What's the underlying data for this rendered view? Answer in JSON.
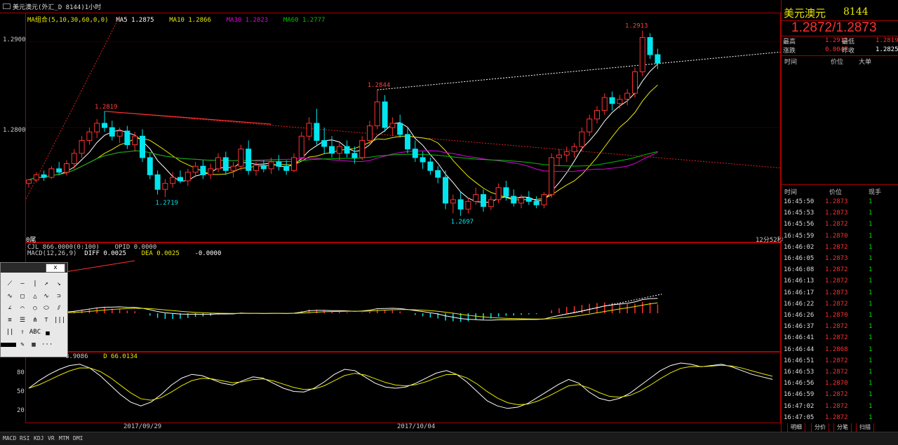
{
  "window": {
    "title": "美元澳元(外汇_D 8144)1小时"
  },
  "main_legend": {
    "ma_group": "MA组合(5,10,30,60,0,0)",
    "ma5": "MA5 1.2875",
    "ma10": "MA10 1.2866",
    "ma30": "MA30 1.2823",
    "ma60": "MA60 1.2777"
  },
  "macd_legend": {
    "cjl": "CJL 866.0000(0:100)",
    "opid": "OPID 0.0000",
    "macd": "MACD(12,26,9)",
    "diff": "DIFF 0.0025",
    "dea": "DEA 0.0025",
    "macd_val": "-0.0000"
  },
  "kdj_legend": {
    "j": "8.9086",
    "d": "D 66.0134"
  },
  "price_axis": [
    "1.2900",
    "1.2800"
  ],
  "kdj_axis": [
    "80",
    "50",
    "20"
  ],
  "date_labels": [
    "2017/09/29",
    "2017/10/04"
  ],
  "price_annotations": {
    "high1": "1.2819",
    "high2": "1.2844",
    "high3": "1.2913",
    "low1": "1.2719",
    "low2": "1.2697"
  },
  "corner_label": "0尾",
  "countdown": "12分52秒",
  "quote": {
    "name": "美元澳元",
    "code": "8144",
    "price": "1.2872/1.2873",
    "high_label": "最高",
    "high": "1.2913",
    "low_label": "最低",
    "low": "1.2819",
    "change_label": "涨跌",
    "change": "0.0047",
    "prev_label": "昨收",
    "prev": "1.2825"
  },
  "big_order_headers": [
    "时间",
    "价位",
    "大单"
  ],
  "tick_headers": [
    "时间",
    "价位",
    "现手"
  ],
  "ticks": [
    [
      "16:45:50",
      "1.2873",
      "1"
    ],
    [
      "16:45:53",
      "1.2873",
      "1"
    ],
    [
      "16:45:56",
      "1.2872",
      "1"
    ],
    [
      "16:45:59",
      "1.2870",
      "1"
    ],
    [
      "16:46:02",
      "1.2872",
      "1"
    ],
    [
      "16:46:05",
      "1.2873",
      "1"
    ],
    [
      "16:46:08",
      "1.2872",
      "1"
    ],
    [
      "16:46:13",
      "1.2872",
      "1"
    ],
    [
      "16:46:17",
      "1.2873",
      "1"
    ],
    [
      "16:46:22",
      "1.2872",
      "1"
    ],
    [
      "16:46:26",
      "1.2870",
      "1"
    ],
    [
      "16:46:37",
      "1.2872",
      "1"
    ],
    [
      "16:46:41",
      "1.2872",
      "1"
    ],
    [
      "16:46:44",
      "1.2868",
      "1"
    ],
    [
      "16:46:51",
      "1.2872",
      "1"
    ],
    [
      "16:46:53",
      "1.2872",
      "1"
    ],
    [
      "16:46:56",
      "1.2870",
      "1"
    ],
    [
      "16:46:59",
      "1.2872",
      "1"
    ],
    [
      "16:47:02",
      "1.2872",
      "1"
    ],
    [
      "16:47:05",
      "1.2872",
      "1"
    ]
  ],
  "right_tabs": [
    "明细",
    "分价",
    "分笔",
    "扫描"
  ],
  "bottom_tabs": [
    "MACD",
    "RSI",
    "KDJ",
    "VR",
    "MTM",
    "DMI"
  ],
  "toolbox": {
    "close": "x",
    "abc": "ABC"
  },
  "colors": {
    "up": "#ff3030",
    "down": "#00e5ee",
    "ma5": "#ffffff",
    "ma10": "#e8e800",
    "ma30": "#e000e0",
    "ma60": "#00c000",
    "frame": "#aa0000"
  },
  "chart_data": {
    "type": "candlestick",
    "title": "",
    "ylim": [
      1.268,
      1.2925
    ],
    "candles": [
      [
        1.2735,
        1.274,
        1.273,
        1.2739
      ],
      [
        1.2739,
        1.2748,
        1.2736,
        1.2745
      ],
      [
        1.2745,
        1.275,
        1.2738,
        1.2742
      ],
      [
        1.2742,
        1.2755,
        1.274,
        1.2752
      ],
      [
        1.2752,
        1.276,
        1.2745,
        1.2748
      ],
      [
        1.2748,
        1.2762,
        1.2744,
        1.2758
      ],
      [
        1.2758,
        1.2775,
        1.2752,
        1.277
      ],
      [
        1.277,
        1.279,
        1.2765,
        1.2785
      ],
      [
        1.2785,
        1.28,
        1.278,
        1.2795
      ],
      [
        1.2795,
        1.281,
        1.2788,
        1.2805
      ],
      [
        1.2805,
        1.2819,
        1.2795,
        1.28
      ],
      [
        1.28,
        1.2808,
        1.2785,
        1.279
      ],
      [
        1.279,
        1.28,
        1.2782,
        1.2796
      ],
      [
        1.2796,
        1.2802,
        1.2775,
        1.278
      ],
      [
        1.278,
        1.2795,
        1.2772,
        1.279
      ],
      [
        1.279,
        1.2798,
        1.276,
        1.2765
      ],
      [
        1.2765,
        1.277,
        1.274,
        1.2745
      ],
      [
        1.2745,
        1.275,
        1.2722,
        1.2728
      ],
      [
        1.2728,
        1.274,
        1.2719,
        1.2735
      ],
      [
        1.2735,
        1.2748,
        1.273,
        1.2742
      ],
      [
        1.2742,
        1.275,
        1.2735,
        1.2738
      ],
      [
        1.2738,
        1.2752,
        1.2732,
        1.2748
      ],
      [
        1.2748,
        1.276,
        1.2742,
        1.2755
      ],
      [
        1.2755,
        1.2762,
        1.274,
        1.2745
      ],
      [
        1.2745,
        1.2758,
        1.274,
        1.2752
      ],
      [
        1.2752,
        1.277,
        1.2748,
        1.2765
      ],
      [
        1.2765,
        1.2772,
        1.2745,
        1.275
      ],
      [
        1.275,
        1.276,
        1.2742,
        1.2755
      ],
      [
        1.2755,
        1.278,
        1.275,
        1.2775
      ],
      [
        1.2775,
        1.2785,
        1.2745,
        1.275
      ],
      [
        1.275,
        1.276,
        1.2744,
        1.2756
      ],
      [
        1.2756,
        1.2762,
        1.2748,
        1.2752
      ],
      [
        1.2752,
        1.2765,
        1.2746,
        1.276
      ],
      [
        1.276,
        1.2768,
        1.275,
        1.2755
      ],
      [
        1.2755,
        1.2762,
        1.2745,
        1.275
      ],
      [
        1.275,
        1.277,
        1.2748,
        1.2765
      ],
      [
        1.2765,
        1.2795,
        1.276,
        1.279
      ],
      [
        1.279,
        1.2812,
        1.2785,
        1.2805
      ],
      [
        1.2805,
        1.2822,
        1.278,
        1.2785
      ],
      [
        1.2785,
        1.28,
        1.277,
        1.2778
      ],
      [
        1.2778,
        1.279,
        1.2765,
        1.277
      ],
      [
        1.277,
        1.2782,
        1.2762,
        1.2778
      ],
      [
        1.2778,
        1.2785,
        1.2765,
        1.277
      ],
      [
        1.277,
        1.2778,
        1.2758,
        1.2765
      ],
      [
        1.2765,
        1.279,
        1.2762,
        1.2785
      ],
      [
        1.2785,
        1.2808,
        1.278,
        1.2802
      ],
      [
        1.2802,
        1.2844,
        1.2798,
        1.283
      ],
      [
        1.283,
        1.2838,
        1.2795,
        1.28
      ],
      [
        1.28,
        1.2812,
        1.279,
        1.2805
      ],
      [
        1.2805,
        1.2815,
        1.2788,
        1.2792
      ],
      [
        1.2792,
        1.28,
        1.277,
        1.2775
      ],
      [
        1.2775,
        1.2785,
        1.276,
        1.2765
      ],
      [
        1.2765,
        1.2772,
        1.2752,
        1.276
      ],
      [
        1.276,
        1.2765,
        1.2745,
        1.275
      ],
      [
        1.275,
        1.2755,
        1.2735,
        1.2742
      ],
      [
        1.2742,
        1.275,
        1.2705,
        1.2712
      ],
      [
        1.2712,
        1.2722,
        1.27,
        1.2716
      ],
      [
        1.2716,
        1.2725,
        1.2697,
        1.2705
      ],
      [
        1.2705,
        1.2718,
        1.27,
        1.2714
      ],
      [
        1.2714,
        1.273,
        1.271,
        1.2722
      ],
      [
        1.2722,
        1.2728,
        1.2702,
        1.2708
      ],
      [
        1.2708,
        1.272,
        1.2704,
        1.2716
      ],
      [
        1.2716,
        1.2735,
        1.2712,
        1.273
      ],
      [
        1.273,
        1.2738,
        1.2715,
        1.272
      ],
      [
        1.272,
        1.2728,
        1.2708,
        1.2712
      ],
      [
        1.2712,
        1.2722,
        1.2706,
        1.2718
      ],
      [
        1.2718,
        1.2726,
        1.271,
        1.2714
      ],
      [
        1.2714,
        1.272,
        1.2706,
        1.271
      ],
      [
        1.271,
        1.2725,
        1.2706,
        1.2722
      ],
      [
        1.2722,
        1.277,
        1.2718,
        1.2765
      ],
      [
        1.2765,
        1.2775,
        1.2755,
        1.2768
      ],
      [
        1.2768,
        1.2778,
        1.276,
        1.2772
      ],
      [
        1.2772,
        1.2782,
        1.2765,
        1.2778
      ],
      [
        1.2778,
        1.28,
        1.2772,
        1.2795
      ],
      [
        1.2795,
        1.2815,
        1.279,
        1.281
      ],
      [
        1.281,
        1.2825,
        1.2805,
        1.282
      ],
      [
        1.282,
        1.284,
        1.2815,
        1.2835
      ],
      [
        1.2835,
        1.2842,
        1.282,
        1.2828
      ],
      [
        1.2828,
        1.2838,
        1.2822,
        1.2833
      ],
      [
        1.2833,
        1.2845,
        1.2826,
        1.284
      ],
      [
        1.284,
        1.287,
        1.2835,
        1.2865
      ],
      [
        1.2865,
        1.2913,
        1.286,
        1.2905
      ],
      [
        1.2905,
        1.291,
        1.288,
        1.2885
      ],
      [
        1.2885,
        1.2892,
        1.2868,
        1.2875
      ]
    ],
    "kdj": [
      50,
      62,
      72,
      80,
      86,
      88,
      82,
      70,
      55,
      40,
      28,
      22,
      28,
      40,
      55,
      66,
      72,
      70,
      64,
      58,
      55,
      62,
      68,
      66,
      58,
      50,
      45,
      44,
      50,
      60,
      72,
      80,
      78,
      68,
      58,
      52,
      50,
      52,
      58,
      66,
      74,
      78,
      72,
      60,
      45,
      30,
      22,
      18,
      20,
      26,
      36,
      46,
      56,
      64,
      58,
      44,
      34,
      30,
      34,
      42,
      54,
      66,
      78,
      86,
      90,
      88,
      84,
      86,
      88,
      84,
      78,
      72,
      68,
      64
    ]
  }
}
